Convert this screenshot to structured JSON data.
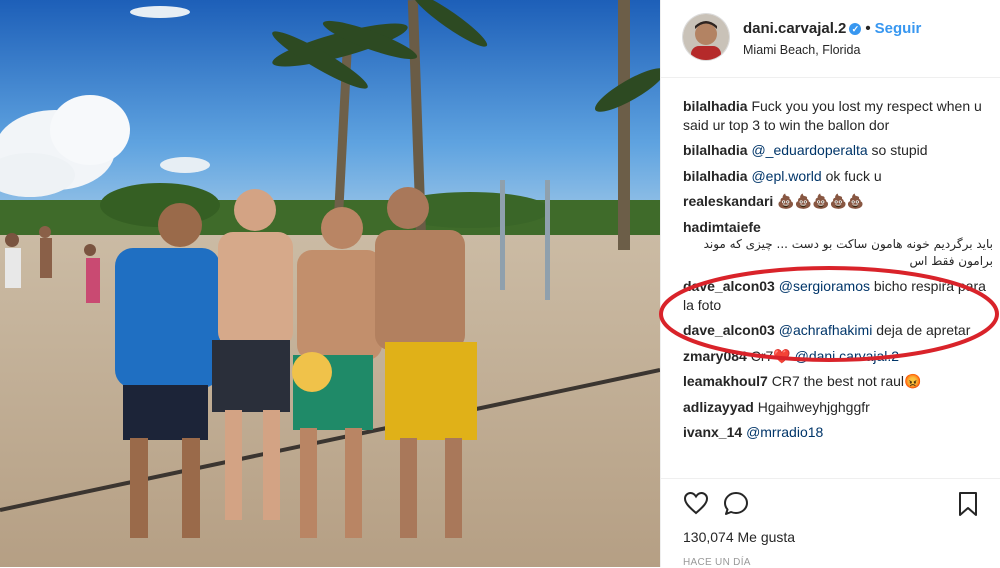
{
  "post": {
    "username": "dani.carvajal.2",
    "follow_label": "Seguir",
    "location": "Miami Beach, Florida",
    "verified_glyph": "✓",
    "separator": "•"
  },
  "comments": [
    {
      "user": "bilalhadia",
      "text": "Fuck you you lost my respect when u said ur top 3 to win the ballon dor"
    },
    {
      "user": "bilalhadia",
      "mention": "@_eduardoperalta",
      "text": " so stupid"
    },
    {
      "user": "bilalhadia",
      "mention": "@epl.world",
      "text": " ok fuck u"
    },
    {
      "user": "realeskandari",
      "text": "💩💩💩💩💩"
    },
    {
      "user": "hadimtaiefe",
      "text": "باید برگردیم خونه هامون ساکت بو دست ... چیزی که موند برامون فقط اس"
    },
    {
      "user": "dave_alcon03",
      "mention": "@sergioramos",
      "text": " bicho respira para la foto"
    },
    {
      "user": "dave_alcon03",
      "mention": "@achrafhakimi",
      "text": " deja de apretar"
    },
    {
      "user": "zmary084",
      "text": "Cr7❤️",
      "mention": "@dani.carvajal.2"
    },
    {
      "user": "leamakhoul7",
      "text": "CR7 the best not raul😡"
    },
    {
      "user": "adlizayyad",
      "text": "Hgaihweyhjghggfr"
    },
    {
      "user": "ivanx_14",
      "mention": "@mrradio18",
      "text": ""
    }
  ],
  "footer": {
    "likes": "130,074 Me gusta",
    "timestamp": "HACE UN DÍA"
  },
  "colors": {
    "accent": "#3897f0",
    "annotation": "#d9232a",
    "mention": "#003569"
  },
  "icons": [
    "heart-icon",
    "comment-icon",
    "bookmark-icon",
    "verified-icon"
  ]
}
